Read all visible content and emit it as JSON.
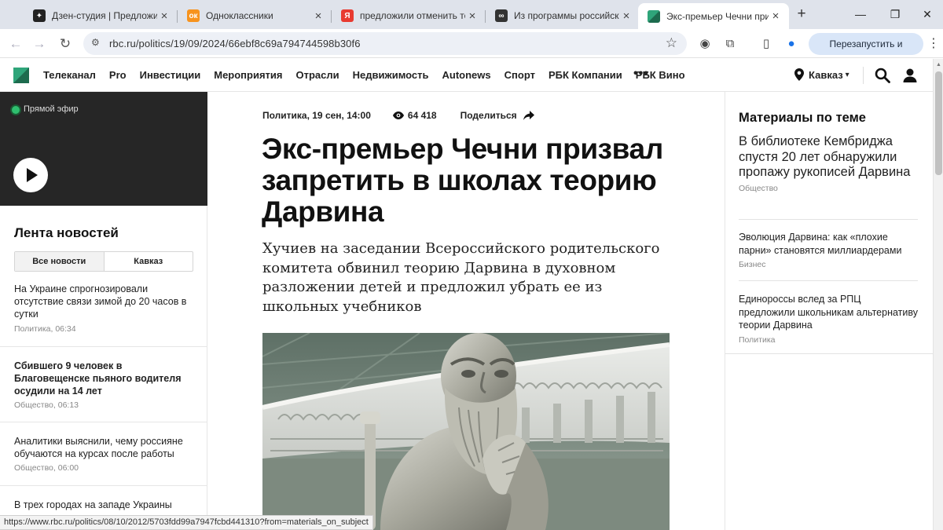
{
  "browser": {
    "tabs": [
      {
        "title": "Дзен-студия | Предложили",
        "favicon": "dzen-icon",
        "color": "#222222",
        "glyph": "✦"
      },
      {
        "title": "Одноклассники",
        "favicon": "ok-icon",
        "color": "#f7931e",
        "glyph": "ок"
      },
      {
        "title": "предложили отменить теор",
        "favicon": "yandex-icon",
        "color": "#e83a30",
        "glyph": "Я"
      },
      {
        "title": "Из программы российских",
        "favicon": "link-icon",
        "color": "#333333",
        "glyph": "∞"
      },
      {
        "title": "Экс-премьер Чечни призв",
        "favicon": "rbc-icon",
        "color": "#1d6b4e",
        "glyph": ""
      }
    ],
    "new_tab": "+",
    "minimize": "—",
    "restore": "❐",
    "close": "✕",
    "url": "rbc.ru/politics/19/09/2024/66ebf8c69a794744598b30f6",
    "relaunch_label": "Перезапустить и обновить",
    "status_url": "https://www.rbc.ru/politics/08/10/2012/5703fdd99a7947fcbd441310?from=materials_on_subject"
  },
  "site": {
    "nav": [
      "Телеканал",
      "Pro",
      "Инвестиции",
      "Мероприятия",
      "Отрасли",
      "Недвижимость",
      "Autonews",
      "Спорт",
      "РБК Компании",
      "РБК Вино"
    ],
    "more": "•••",
    "region": "Кавказ",
    "region_caret": "▾"
  },
  "live": {
    "label": "Прямой эфир"
  },
  "feed": {
    "title": "Лента новостей",
    "tabs": [
      "Все новости",
      "Кавказ"
    ],
    "items": [
      {
        "title": "На Украине спрогнозировали отсутствие связи зимой до 20 часов в сутки",
        "meta": "Политика, 06:34",
        "bold": false
      },
      {
        "title": "Сбившего 9 человек в Благовещенске пьяного водителя осудили на 14 лет",
        "meta": "Общество, 06:13",
        "bold": true
      },
      {
        "title": "Аналитики выяснили, чему россияне обучаются на курсах после работы",
        "meta": "Общество, 06:00",
        "bold": false
      },
      {
        "title": "В трех городах на западе Украины",
        "meta": "",
        "bold": false
      }
    ]
  },
  "article": {
    "meta": "Политика, 19 сен, 14:00",
    "views": "64 418",
    "share": "Поделиться",
    "headline": "Экс-премьер Чечни призвал запретить в школах теорию Дарвина",
    "lead": "Хучиев на заседании Всероссийского родительского комитета обвинил теорию Дарвина в духовном разложении детей и предложил убрать ее из школьных учебников"
  },
  "related": {
    "title": "Материалы по теме",
    "items": [
      {
        "title": "В библиотеке Кембриджа спустя 20 лет обнаружили пропажу рукописей Дарвина",
        "category": "Общество"
      },
      {
        "title": "Эволюция Дарвина: как «плохие парни» становятся миллиардерами",
        "category": "Бизнес"
      },
      {
        "title": "Единороссы вслед за РПЦ предложили школьникам альтернативу теории Дарвина",
        "category": "Политика"
      }
    ]
  },
  "colors": {
    "brand": "#1d6b4e",
    "live_dot": "#2fbf6f",
    "relaunch_bg": "#d9e6f8"
  }
}
